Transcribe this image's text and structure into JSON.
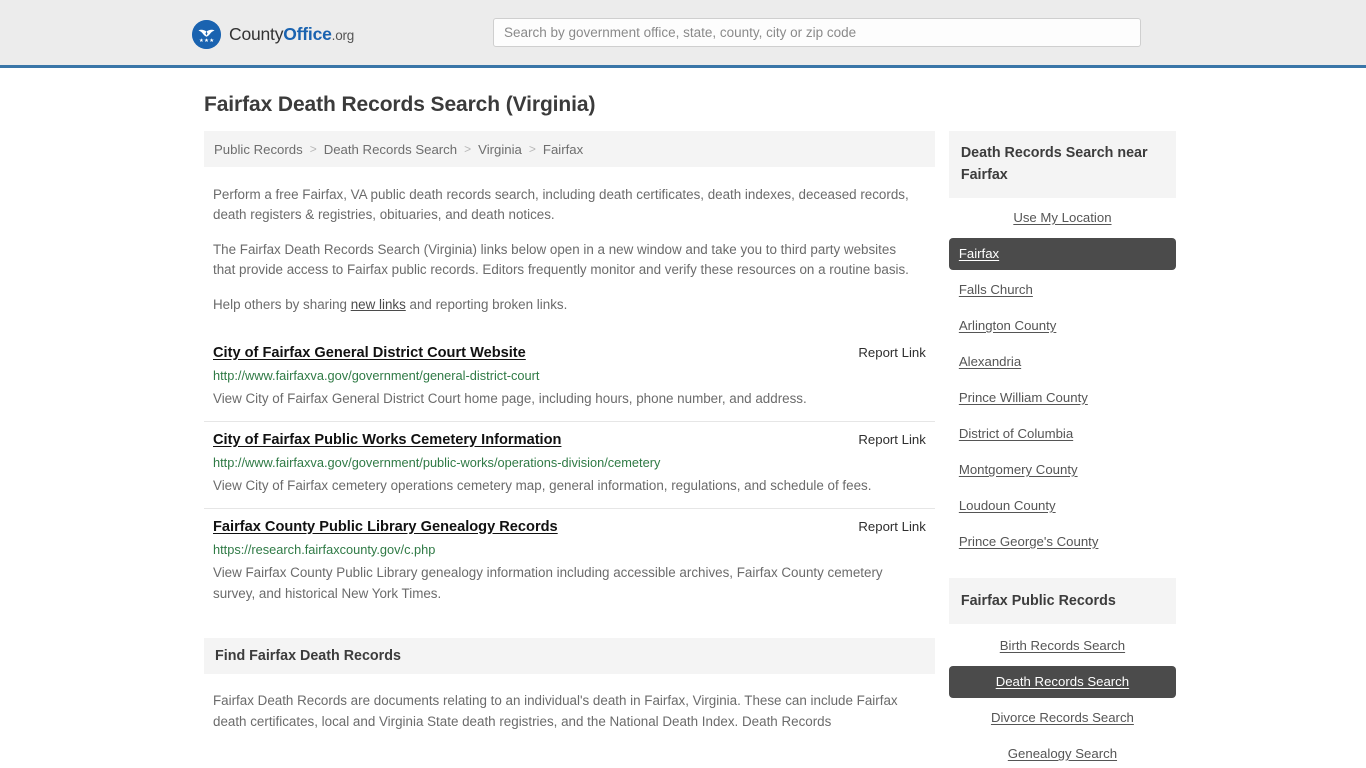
{
  "header": {
    "logo_text_part1": "County",
    "logo_text_part2": "Office",
    "logo_text_tld": ".org",
    "logo_icon": "eagle-shield-icon",
    "search_placeholder": "Search by government office, state, county, city or zip code",
    "search_value": "",
    "accent_color": "#3a76a8"
  },
  "page": {
    "title": "Fairfax Death Records Search (Virginia)"
  },
  "breadcrumb": {
    "separator": ">",
    "items": [
      {
        "label": "Public Records"
      },
      {
        "label": "Death Records Search"
      },
      {
        "label": "Virginia"
      },
      {
        "label": "Fairfax"
      }
    ]
  },
  "intro": {
    "paragraph_1": "Perform a free Fairfax, VA public death records search, including death certificates, death indexes, deceased records, death registers & registries, obituaries, and death notices.",
    "paragraph_2": "The Fairfax Death Records Search (Virginia) links below open in a new window and take you to third party websites that provide access to Fairfax public records. Editors frequently monitor and verify these resources on a routine basis.",
    "paragraph_3_before": "Help others by sharing ",
    "paragraph_3_link": "new links",
    "paragraph_3_after": " and reporting broken links."
  },
  "results": {
    "report_label": "Report Link",
    "items": [
      {
        "title": "City of Fairfax General District Court Website",
        "url": "http://www.fairfaxva.gov/government/general-district-court",
        "description": "View City of Fairfax General District Court home page, including hours, phone number, and address."
      },
      {
        "title": "City of Fairfax Public Works Cemetery Information",
        "url": "http://www.fairfaxva.gov/government/public-works/operations-division/cemetery",
        "description": "View City of Fairfax cemetery operations cemetery map, general information, regulations, and schedule of fees."
      },
      {
        "title": "Fairfax County Public Library Genealogy Records",
        "url": "https://research.fairfaxcounty.gov/c.php",
        "description": "View Fairfax County Public Library genealogy information including accessible archives, Fairfax County cemetery survey, and historical New York Times."
      }
    ]
  },
  "find_section": {
    "heading": "Find Fairfax Death Records",
    "body": "Fairfax Death Records are documents relating to an individual's death in Fairfax, Virginia. These can include Fairfax death certificates, local and Virginia State death registries, and the National Death Index. Death Records"
  },
  "sidebar": {
    "nearby": {
      "heading": "Death Records Search near Fairfax",
      "items": [
        {
          "label": "Use My Location",
          "active": false
        },
        {
          "label": "Fairfax",
          "active": true
        },
        {
          "label": "Falls Church",
          "active": false
        },
        {
          "label": "Arlington County",
          "active": false
        },
        {
          "label": "Alexandria",
          "active": false
        },
        {
          "label": "Prince William County",
          "active": false
        },
        {
          "label": "District of Columbia",
          "active": false
        },
        {
          "label": "Montgomery County",
          "active": false
        },
        {
          "label": "Loudoun County",
          "active": false
        },
        {
          "label": "Prince George's County",
          "active": false
        }
      ]
    },
    "public_records": {
      "heading": "Fairfax Public Records",
      "items": [
        {
          "label": "Birth Records Search",
          "active": false
        },
        {
          "label": "Death Records Search",
          "active": true
        },
        {
          "label": "Divorce Records Search",
          "active": false
        },
        {
          "label": "Genealogy Search",
          "active": false
        }
      ]
    },
    "active_bg_color": "#4b4b4b"
  }
}
